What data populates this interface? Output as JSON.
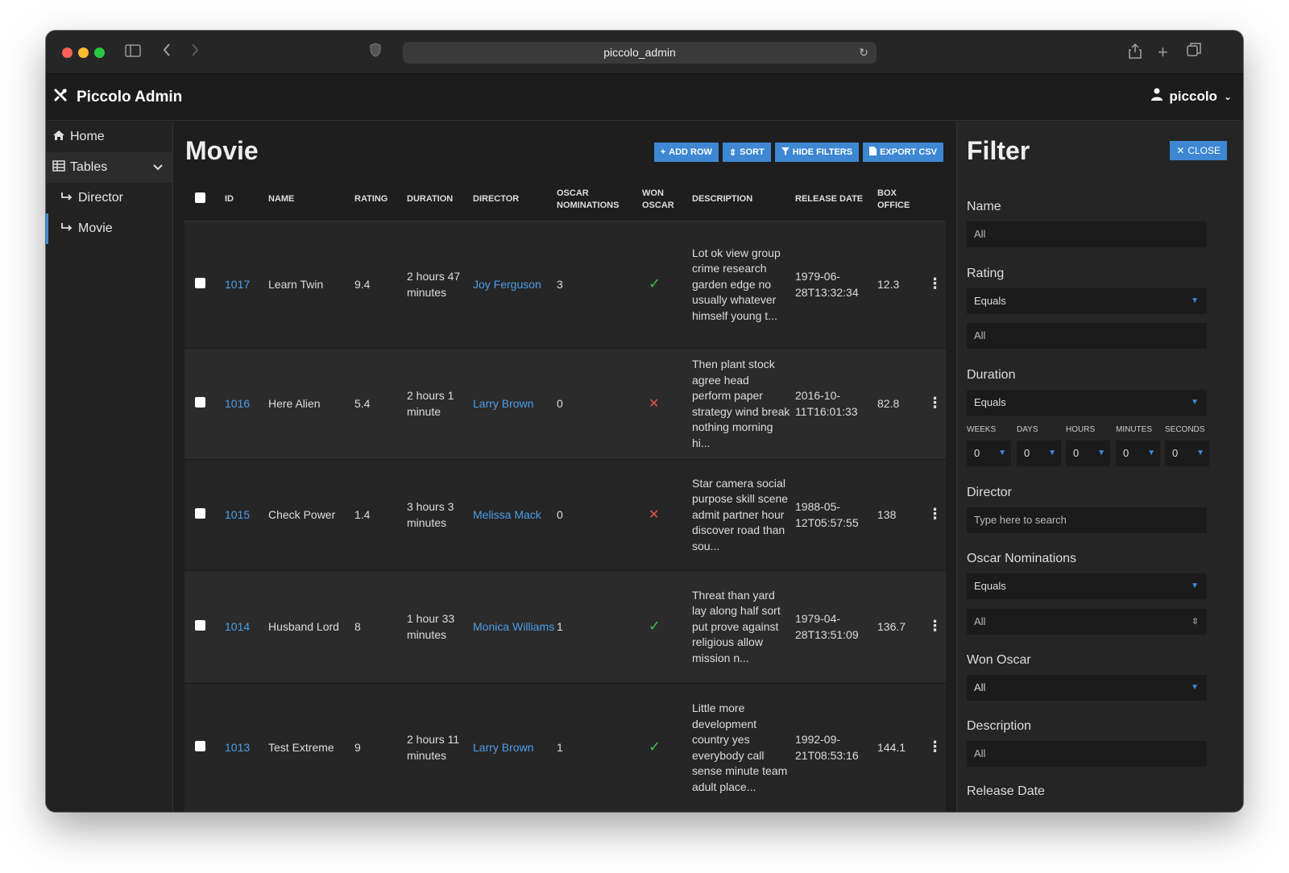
{
  "browser": {
    "url": "piccolo_admin"
  },
  "header": {
    "brand": "Piccolo Admin",
    "user": "piccolo"
  },
  "sidebar": {
    "items": [
      {
        "label": "Home",
        "icon": "home-icon"
      },
      {
        "label": "Tables",
        "icon": "table-icon"
      },
      {
        "label": "Director",
        "icon": "subitem-arrow-icon"
      },
      {
        "label": "Movie",
        "icon": "subitem-arrow-icon"
      }
    ]
  },
  "main": {
    "title": "Movie",
    "toolbar": {
      "add_row": "ADD ROW",
      "sort": "SORT",
      "hide_filters": "HIDE FILTERS",
      "export_csv": "EXPORT CSV"
    },
    "columns": [
      "ID",
      "NAME",
      "RATING",
      "DURATION",
      "DIRECTOR",
      "OSCAR NOMINATIONS",
      "WON OSCAR",
      "DESCRIPTION",
      "RELEASE DATE",
      "BOX OFFICE"
    ],
    "rows": [
      {
        "id": "1017",
        "name": "Learn Twin",
        "rating": "9.4",
        "duration": "2 hours 47 minutes",
        "director": "Joy Ferguson",
        "oscar_nominations": "3",
        "won_oscar": true,
        "description": "Lot ok view group crime research garden edge no usually whatever himself young t...",
        "release_date": "1979-06-28T13:32:34",
        "box_office": "12.3"
      },
      {
        "id": "1016",
        "name": "Here Alien",
        "rating": "5.4",
        "duration": "2 hours 1 minute",
        "director": "Larry Brown",
        "oscar_nominations": "0",
        "won_oscar": false,
        "description": "Then plant stock agree head perform paper strategy wind break nothing morning hi...",
        "release_date": "2016-10-11T16:01:33",
        "box_office": "82.8"
      },
      {
        "id": "1015",
        "name": "Check Power",
        "rating": "1.4",
        "duration": "3 hours 3 minutes",
        "director": "Melissa Mack",
        "oscar_nominations": "0",
        "won_oscar": false,
        "description": "Star camera social purpose skill scene admit partner hour discover road than sou...",
        "release_date": "1988-05-12T05:57:55",
        "box_office": "138"
      },
      {
        "id": "1014",
        "name": "Husband Lord",
        "rating": "8",
        "duration": "1 hour 33 minutes",
        "director": "Monica Williams",
        "oscar_nominations": "1",
        "won_oscar": true,
        "description": "Threat than yard lay along half sort put prove against religious allow mission n...",
        "release_date": "1979-04-28T13:51:09",
        "box_office": "136.7"
      },
      {
        "id": "1013",
        "name": "Test Extreme",
        "rating": "9",
        "duration": "2 hours 11 minutes",
        "director": "Larry Brown",
        "oscar_nominations": "1",
        "won_oscar": true,
        "description": "Little more development country yes everybody call sense minute team adult place...",
        "release_date": "1992-09-21T08:53:16",
        "box_office": "144.1"
      }
    ]
  },
  "filter": {
    "title": "Filter",
    "close": "CLOSE",
    "name": {
      "label": "Name",
      "value": "All"
    },
    "rating": {
      "label": "Rating",
      "operator": "Equals",
      "value": "All"
    },
    "duration": {
      "label": "Duration",
      "operator": "Equals",
      "units": [
        {
          "label": "WEEKS",
          "value": "0"
        },
        {
          "label": "DAYS",
          "value": "0"
        },
        {
          "label": "HOURS",
          "value": "0"
        },
        {
          "label": "MINUTES",
          "value": "0"
        },
        {
          "label": "SECONDS",
          "value": "0"
        }
      ]
    },
    "director": {
      "label": "Director",
      "placeholder": "Type here to search"
    },
    "oscar_nominations": {
      "label": "Oscar Nominations",
      "operator": "Equals",
      "value": "All"
    },
    "won_oscar": {
      "label": "Won Oscar",
      "value": "All"
    },
    "description": {
      "label": "Description",
      "value": "All"
    },
    "release_date": {
      "label": "Release Date"
    }
  },
  "colors": {
    "accent": "#3d87d3",
    "link": "#4b9ee8",
    "success": "#3fb950",
    "danger": "#e5534b",
    "background": "#1e1e1e"
  }
}
